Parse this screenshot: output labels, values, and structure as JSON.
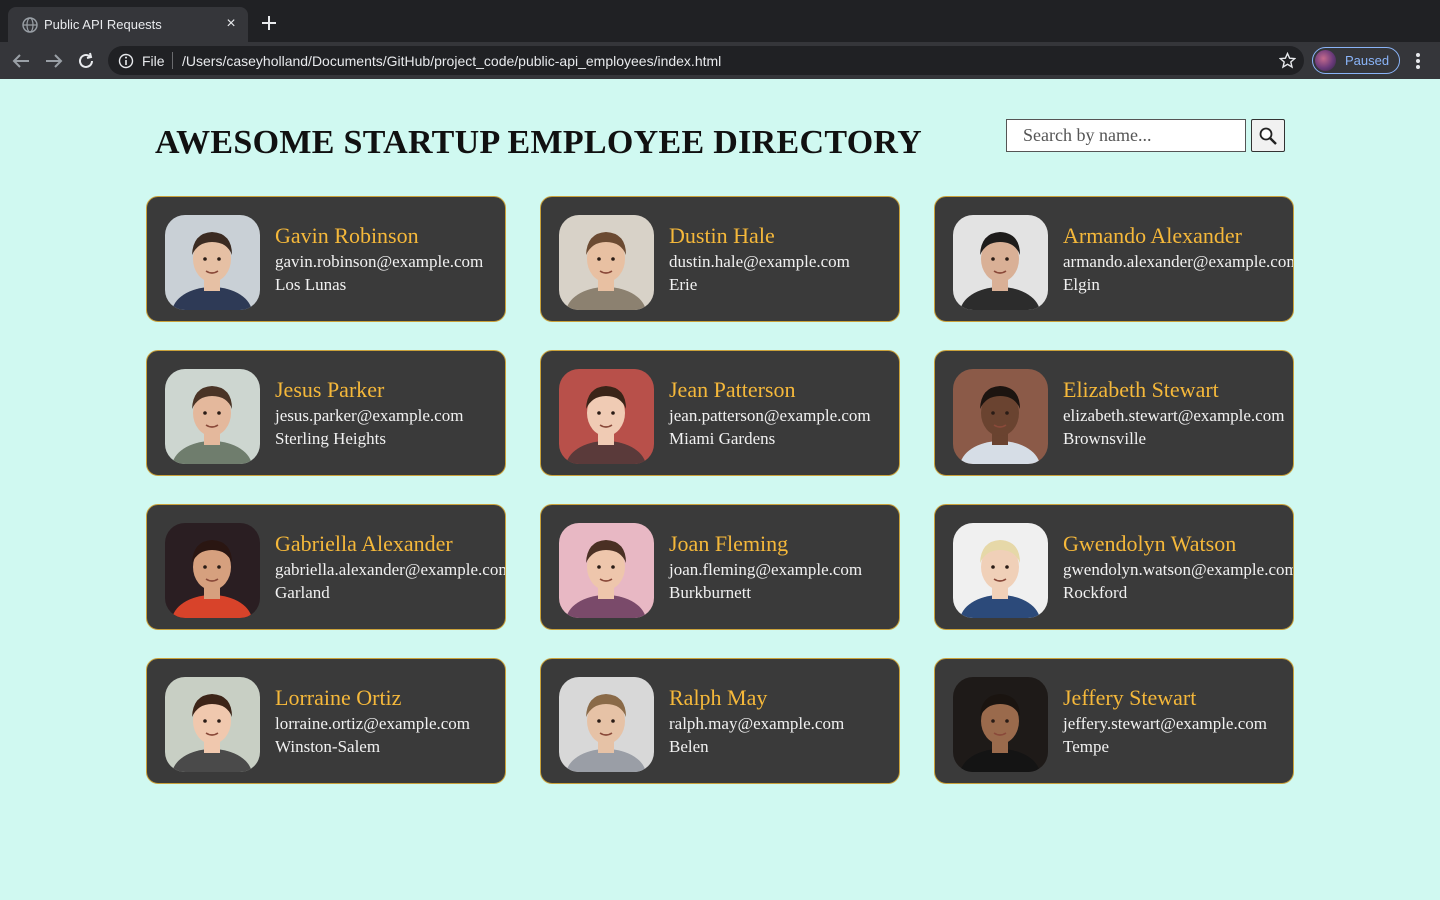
{
  "browser": {
    "tab_title": "Public API Requests",
    "tab_close": "×",
    "scheme": "File",
    "url": "/Users/caseyholland/Documents/GitHub/project_code/public-api_employees/index.html",
    "profile_status": "Paused"
  },
  "page": {
    "title": "AWESOME STARTUP EMPLOYEE DIRECTORY",
    "search_placeholder": "Search by name..."
  },
  "employees": [
    {
      "name": "Gavin Robinson",
      "email": "gavin.robinson@example.com",
      "city": "Los Lunas",
      "bg": "#c9d0d6",
      "skin": "#e6c0a4",
      "hair": "#3b2b22",
      "shirt": "#2e3a56"
    },
    {
      "name": "Dustin Hale",
      "email": "dustin.hale@example.com",
      "city": "Erie",
      "bg": "#d8d2c8",
      "skin": "#e8c0a2",
      "hair": "#6b4a32",
      "shirt": "#8c8170"
    },
    {
      "name": "Armando Alexander",
      "email": "armando.alexander@example.com",
      "city": "Elgin",
      "bg": "#e3e3e3",
      "skin": "#d9b096",
      "hair": "#1e1c1b",
      "shirt": "#2c2c2c"
    },
    {
      "name": "Jesus Parker",
      "email": "jesus.parker@example.com",
      "city": "Sterling Heights",
      "bg": "#cdd6d0",
      "skin": "#e4b89c",
      "hair": "#4a3426",
      "shirt": "#6f7d6d"
    },
    {
      "name": "Jean Patterson",
      "email": "jean.patterson@example.com",
      "city": "Miami Gardens",
      "bg": "#b8504a",
      "skin": "#f0cbb4",
      "hair": "#3a2418",
      "shirt": "#5a3a3a"
    },
    {
      "name": "Elizabeth Stewart",
      "email": "elizabeth.stewart@example.com",
      "city": "Brownsville",
      "bg": "#8b5a48",
      "skin": "#6a4330",
      "hair": "#1c1410",
      "shirt": "#d6dde6"
    },
    {
      "name": "Gabriella Alexander",
      "email": "gabriella.alexander@example.com",
      "city": "Garland",
      "bg": "#2a1e22",
      "skin": "#d6a07e",
      "hair": "#2a1612",
      "shirt": "#d8432a"
    },
    {
      "name": "Joan Fleming",
      "email": "joan.fleming@example.com",
      "city": "Burkburnett",
      "bg": "#e8b8c4",
      "skin": "#eec6ac",
      "hair": "#4a3024",
      "shirt": "#7a4a6a"
    },
    {
      "name": "Gwendolyn Watson",
      "email": "gwendolyn.watson@example.com",
      "city": "Rockford",
      "bg": "#f0f0f0",
      "skin": "#f0d0b8",
      "hair": "#e6d8a8",
      "shirt": "#2c4a7a"
    },
    {
      "name": "Lorraine Ortiz",
      "email": "lorraine.ortiz@example.com",
      "city": "Winston-Salem",
      "bg": "#c8cfc4",
      "skin": "#f0c8ae",
      "hair": "#3c2418",
      "shirt": "#4a4a4a"
    },
    {
      "name": "Ralph May",
      "email": "ralph.may@example.com",
      "city": "Belen",
      "bg": "#d8d8d8",
      "skin": "#e6c2a6",
      "hair": "#8a6a48",
      "shirt": "#9a9ea6"
    },
    {
      "name": "Jeffery Stewart",
      "email": "jeffery.stewart@example.com",
      "city": "Tempe",
      "bg": "#1e1a18",
      "skin": "#9a6a4c",
      "hair": "#1a1410",
      "shirt": "#141414"
    }
  ]
}
